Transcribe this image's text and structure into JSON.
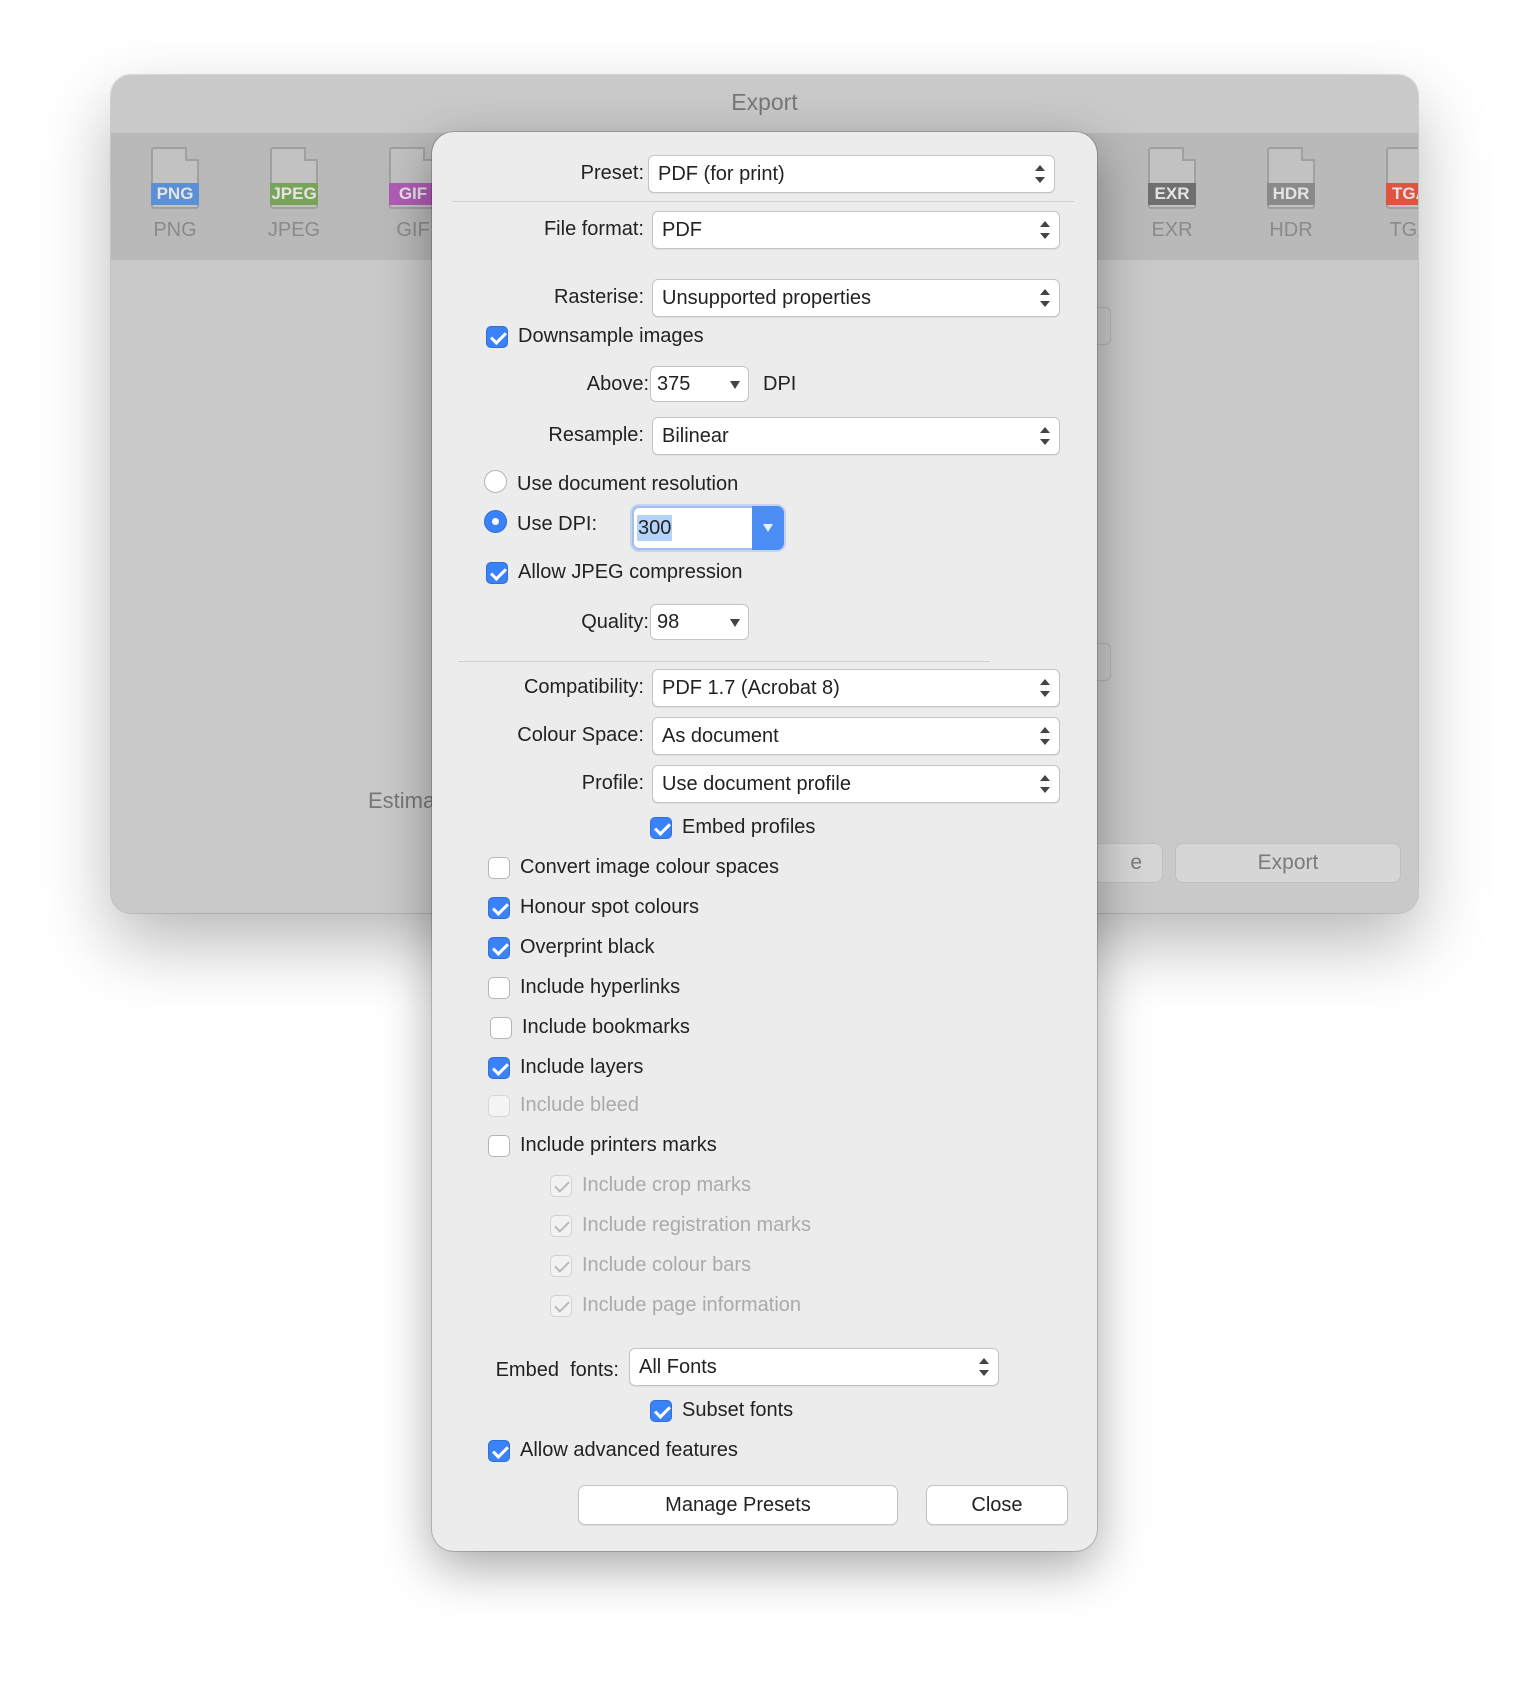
{
  "export_window": {
    "title": "Export",
    "formats": [
      {
        "band": "PNG",
        "name": "PNG",
        "color": "#5b8fd6"
      },
      {
        "band": "JPEG",
        "name": "JPEG",
        "color": "#7aa35a"
      },
      {
        "band": "GIF",
        "name": "GIF",
        "color": "#b05cb6"
      },
      {
        "band": "EXR",
        "name": "EXR",
        "color": "#6f6f6f"
      },
      {
        "band": "HDR",
        "name": "HDR",
        "color": "#8a8a8a"
      },
      {
        "band": "TGA",
        "name": "TGA",
        "color": "#e0533f"
      }
    ],
    "estimate_label": "Estima",
    "save_button_fragment": "e",
    "export_button": "Export"
  },
  "sheet": {
    "preset": {
      "label": "Preset:",
      "value": "PDF (for print)"
    },
    "file_format": {
      "label": "File format:",
      "value": "PDF"
    },
    "rasterise": {
      "label": "Rasterise:",
      "value": "Unsupported properties"
    },
    "downsample": {
      "label": "Downsample images",
      "checked": true
    },
    "above": {
      "label": "Above:",
      "value": "375",
      "unit": "DPI"
    },
    "resample": {
      "label": "Resample:",
      "value": "Bilinear"
    },
    "use_doc_res": {
      "label": "Use document resolution",
      "selected": false
    },
    "use_dpi": {
      "label": "Use DPI:",
      "value": "300",
      "selected": true
    },
    "allow_jpeg": {
      "label": "Allow JPEG compression",
      "checked": true
    },
    "quality": {
      "label": "Quality:",
      "value": "98"
    },
    "compatibility": {
      "label": "Compatibility:",
      "value": "PDF 1.7 (Acrobat 8)"
    },
    "colour_space": {
      "label": "Colour Space:",
      "value": "As document"
    },
    "profile": {
      "label": "Profile:",
      "value": "Use document profile"
    },
    "embed_profiles": {
      "label": "Embed profiles",
      "checked": true
    },
    "options": [
      {
        "label": "Convert image colour spaces",
        "checked": false
      },
      {
        "label": "Honour spot colours",
        "checked": true
      },
      {
        "label": "Overprint black",
        "checked": true
      },
      {
        "label": "Include hyperlinks",
        "checked": false
      },
      {
        "label": "Include bookmarks",
        "checked": false
      },
      {
        "label": "Include layers",
        "checked": true
      },
      {
        "label": "Include bleed",
        "checked": false,
        "disabled": true
      },
      {
        "label": "Include printers marks",
        "checked": false
      }
    ],
    "printer_marks": [
      {
        "label": "Include crop marks"
      },
      {
        "label": "Include registration marks"
      },
      {
        "label": "Include colour bars"
      },
      {
        "label": "Include page information"
      }
    ],
    "embed_fonts": {
      "label": "Embed  fonts:",
      "value": "All Fonts"
    },
    "subset_fonts": {
      "label": "Subset fonts",
      "checked": true
    },
    "advanced": {
      "label": "Allow advanced features",
      "checked": true
    },
    "manage_presets": "Manage Presets",
    "close": "Close"
  }
}
